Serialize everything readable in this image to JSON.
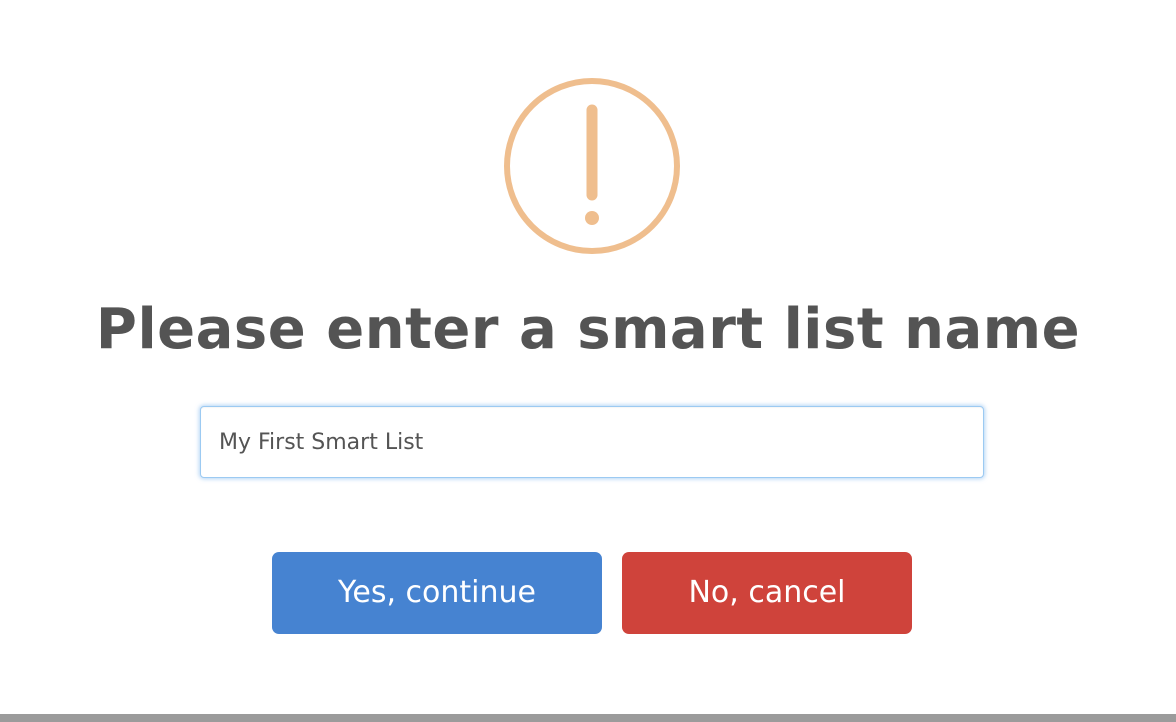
{
  "dialog": {
    "icon": "warning-exclamation-icon",
    "icon_color": "#efbe8e",
    "title": "Please enter a smart list name",
    "input": {
      "value": "My First Smart List",
      "placeholder": ""
    },
    "buttons": {
      "confirm_label": "Yes, continue",
      "cancel_label": "No, cancel"
    }
  },
  "colors": {
    "confirm_button": "#4683d1",
    "cancel_button": "#cf433b",
    "title_text": "#545454",
    "input_focus_border": "#9ccaf2"
  }
}
